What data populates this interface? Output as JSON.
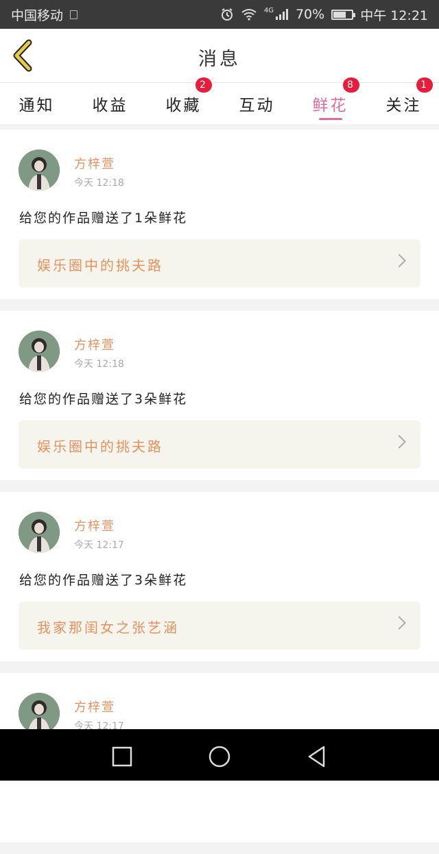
{
  "status_bar": {
    "carrier": "中国移动",
    "network": "4G",
    "battery": "70%",
    "battery_level": 0.7,
    "time": "中午 12:21"
  },
  "header": {
    "title": "消息"
  },
  "tabs": [
    {
      "label": "通知",
      "badge": "",
      "active": false
    },
    {
      "label": "收益",
      "badge": "",
      "active": false
    },
    {
      "label": "收藏",
      "badge": "2",
      "active": false
    },
    {
      "label": "互动",
      "badge": "",
      "active": false
    },
    {
      "label": "鲜花",
      "badge": "8",
      "active": true
    },
    {
      "label": "关注",
      "badge": "1",
      "active": false
    }
  ],
  "messages": [
    {
      "name": "方梓萱",
      "time": "今天  12:18",
      "text": "给您的作品赠送了1朵鲜花",
      "work": "娱乐圈中的挑夫路"
    },
    {
      "name": "方梓萱",
      "time": "今天  12:18",
      "text": "给您的作品赠送了3朵鲜花",
      "work": "娱乐圈中的挑夫路"
    },
    {
      "name": "方梓萱",
      "time": "今天  12:17",
      "text": "给您的作品赠送了3朵鲜花",
      "work": "我家那闺女之张艺涵"
    },
    {
      "name": "方梓萱",
      "time": "今天  12:17",
      "text": "",
      "work": ""
    }
  ],
  "colors": {
    "accent": "#e16aa0",
    "name": "#e8915f",
    "badge": "#e81d3b",
    "back_arrow": "#e6c84a"
  }
}
